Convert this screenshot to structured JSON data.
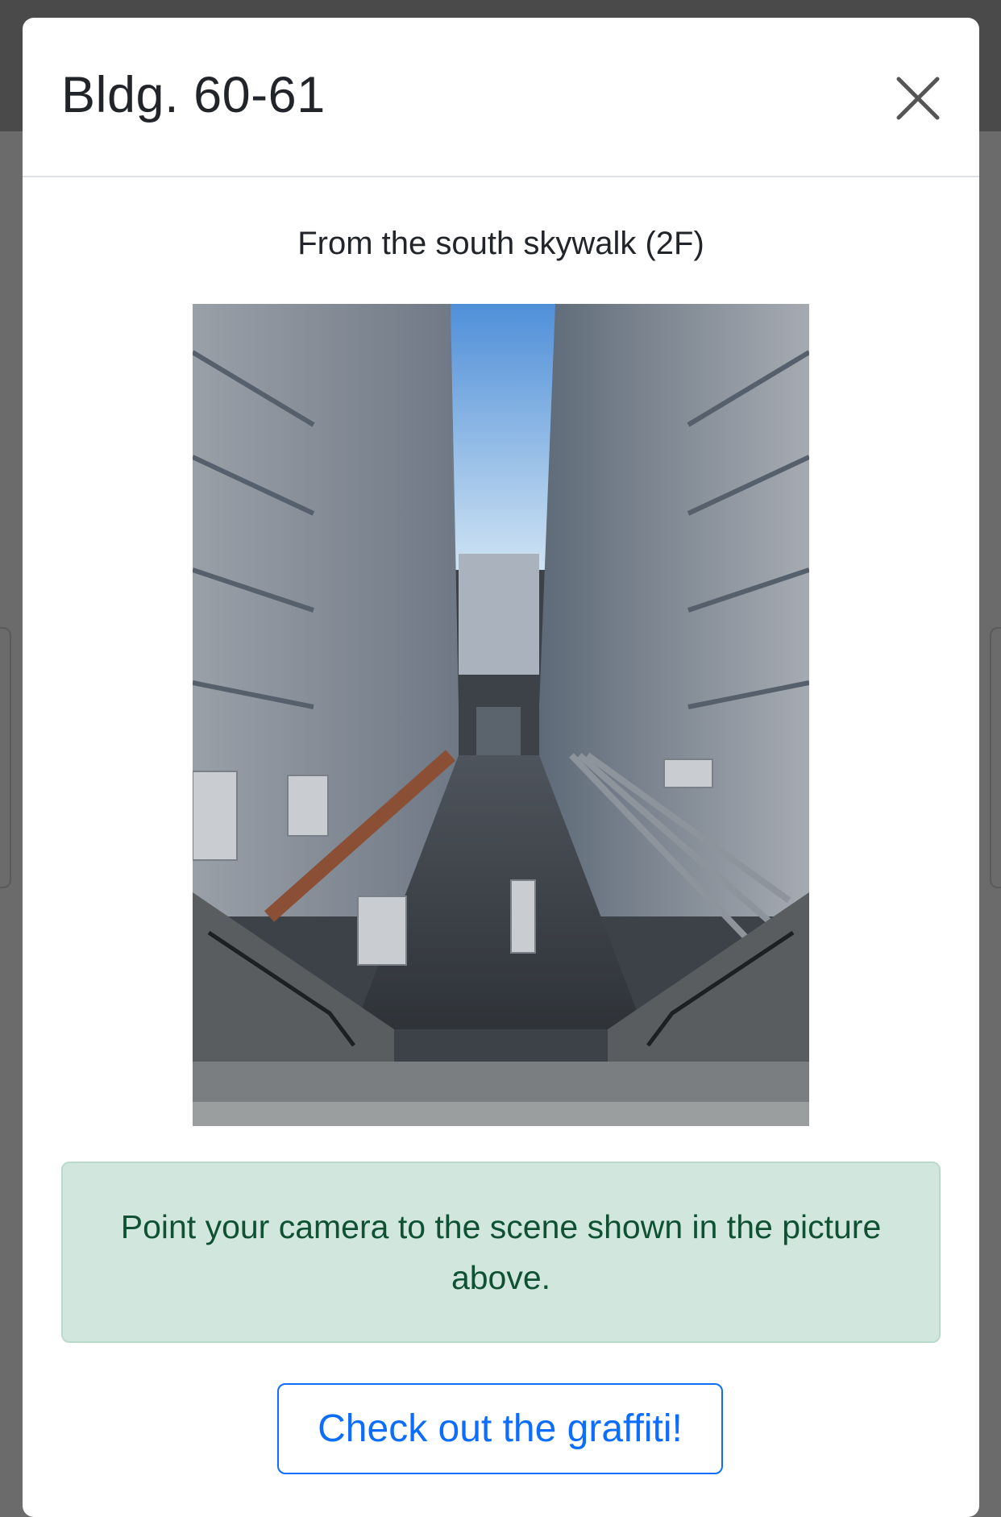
{
  "modal": {
    "title": "Bldg. 60-61",
    "caption": "From the south skywalk (2F)",
    "instruction": "Point your camera to the scene shown in the picture above.",
    "action_label": "Check out the graffiti!",
    "close_icon": "close-icon",
    "photo_alt": ""
  },
  "colors": {
    "primary": "#0d6efd",
    "success_bg": "#d1e7dd",
    "success_text": "#0f5132",
    "overlay": "#6b6b6b"
  }
}
